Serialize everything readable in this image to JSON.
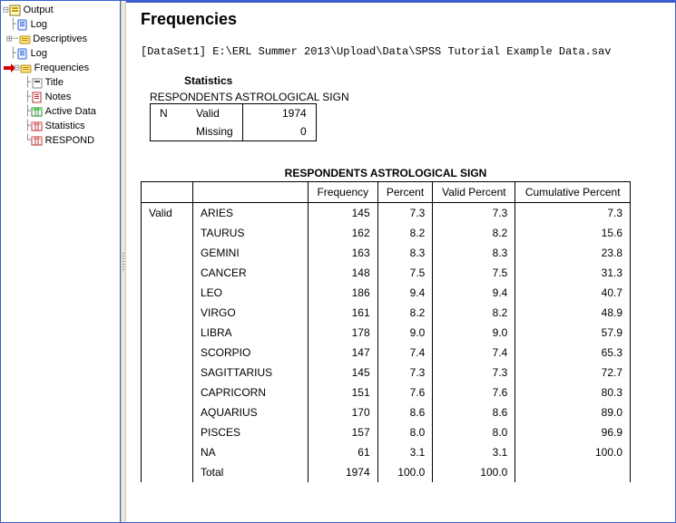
{
  "tree": {
    "root": "Output",
    "items": [
      {
        "icon": "log",
        "label": "Log"
      },
      {
        "icon": "folder",
        "label": "Descriptives"
      },
      {
        "icon": "log",
        "label": "Log"
      },
      {
        "icon": "folder-red",
        "label": "Frequencies",
        "children": [
          {
            "icon": "title",
            "label": "Title"
          },
          {
            "icon": "notes",
            "label": "Notes"
          },
          {
            "icon": "dataset",
            "label": "Active Data"
          },
          {
            "icon": "pivot",
            "label": "Statistics"
          },
          {
            "icon": "pivot",
            "label": "RESPOND"
          }
        ]
      }
    ]
  },
  "output": {
    "heading": "Frequencies",
    "dataset_line": "[DataSet1] E:\\ERL Summer 2013\\Upload\\Data\\SPSS Tutorial Example Data.sav",
    "stats": {
      "title": "Statistics",
      "variable": "RESPONDENTS ASTROLOGICAL SIGN",
      "n_label": "N",
      "valid_label": "Valid",
      "missing_label": "Missing",
      "valid": "1974",
      "missing": "0"
    },
    "freq": {
      "title": "RESPONDENTS ASTROLOGICAL SIGN",
      "stub": "Valid",
      "headers": {
        "cat": "",
        "freq": "Frequency",
        "pct": "Percent",
        "vpct": "Valid Percent",
        "cpct": "Cumulative Percent"
      },
      "rows": [
        {
          "cat": "ARIES",
          "freq": "145",
          "pct": "7.3",
          "vpct": "7.3",
          "cpct": "7.3"
        },
        {
          "cat": "TAURUS",
          "freq": "162",
          "pct": "8.2",
          "vpct": "8.2",
          "cpct": "15.6"
        },
        {
          "cat": "GEMINI",
          "freq": "163",
          "pct": "8.3",
          "vpct": "8.3",
          "cpct": "23.8"
        },
        {
          "cat": "CANCER",
          "freq": "148",
          "pct": "7.5",
          "vpct": "7.5",
          "cpct": "31.3"
        },
        {
          "cat": "LEO",
          "freq": "186",
          "pct": "9.4",
          "vpct": "9.4",
          "cpct": "40.7"
        },
        {
          "cat": "VIRGO",
          "freq": "161",
          "pct": "8.2",
          "vpct": "8.2",
          "cpct": "48.9"
        },
        {
          "cat": "LIBRA",
          "freq": "178",
          "pct": "9.0",
          "vpct": "9.0",
          "cpct": "57.9"
        },
        {
          "cat": "SCORPIO",
          "freq": "147",
          "pct": "7.4",
          "vpct": "7.4",
          "cpct": "65.3"
        },
        {
          "cat": "SAGITTARIUS",
          "freq": "145",
          "pct": "7.3",
          "vpct": "7.3",
          "cpct": "72.7"
        },
        {
          "cat": "CAPRICORN",
          "freq": "151",
          "pct": "7.6",
          "vpct": "7.6",
          "cpct": "80.3"
        },
        {
          "cat": "AQUARIUS",
          "freq": "170",
          "pct": "8.6",
          "vpct": "8.6",
          "cpct": "89.0"
        },
        {
          "cat": "PISCES",
          "freq": "157",
          "pct": "8.0",
          "vpct": "8.0",
          "cpct": "96.9"
        },
        {
          "cat": "NA",
          "freq": "61",
          "pct": "3.1",
          "vpct": "3.1",
          "cpct": "100.0"
        }
      ],
      "total": {
        "cat": "Total",
        "freq": "1974",
        "pct": "100.0",
        "vpct": "100.0",
        "cpct": ""
      }
    }
  }
}
